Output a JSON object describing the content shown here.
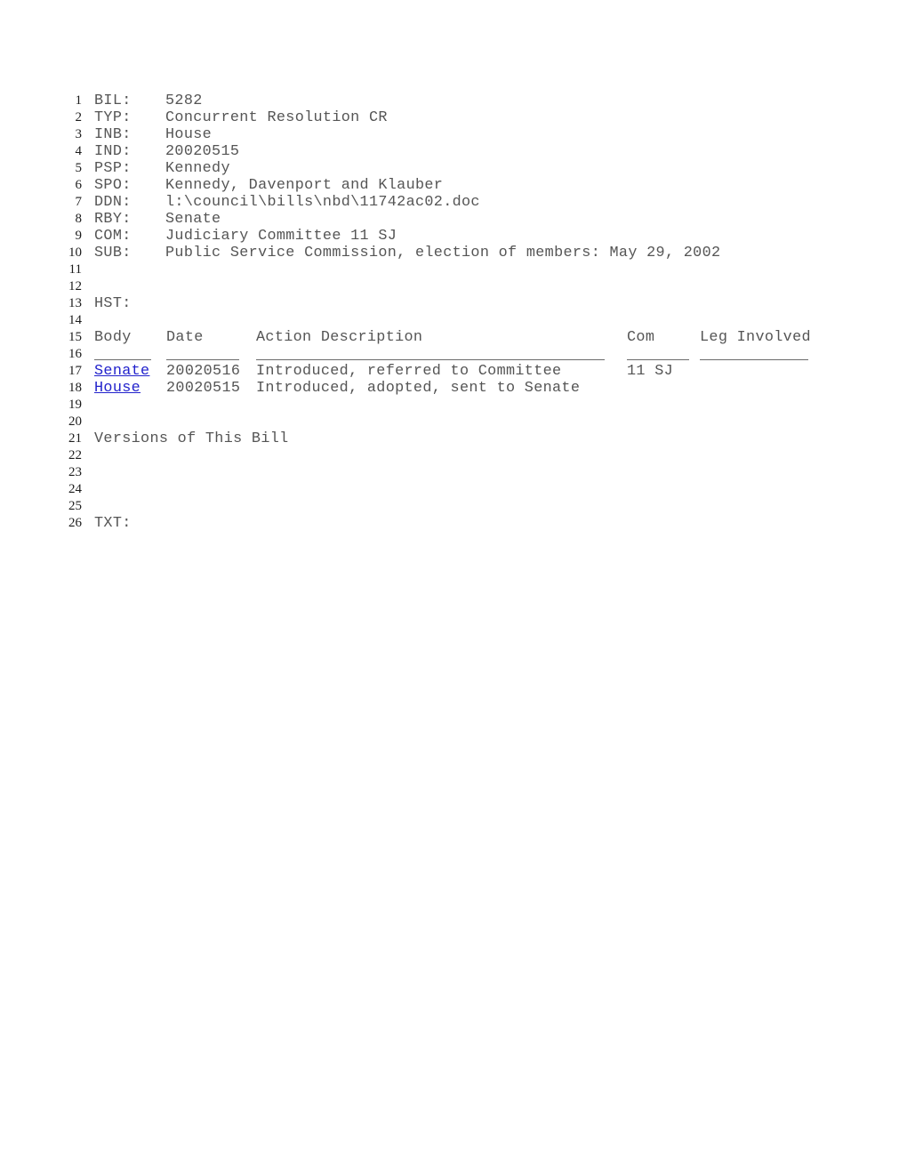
{
  "document": {
    "title": "Bill 5282 Legislative Record",
    "body_text_color": "#555555",
    "link_color": "#2222cc",
    "background_color": "#ffffff"
  },
  "fields": [
    {
      "lineno": "1",
      "label": "BIL:",
      "value": "5282"
    },
    {
      "lineno": "2",
      "label": "TYP:",
      "value": "Concurrent Resolution CR"
    },
    {
      "lineno": "3",
      "label": "INB:",
      "value": "House"
    },
    {
      "lineno": "4",
      "label": "IND:",
      "value": "20020515"
    },
    {
      "lineno": "5",
      "label": "PSP:",
      "value": "Kennedy"
    },
    {
      "lineno": "6",
      "label": "SPO:",
      "value": "Kennedy, Davenport and Klauber"
    },
    {
      "lineno": "7",
      "label": "DDN:",
      "value": "l:\\council\\bills\\nbd\\11742ac02.doc"
    },
    {
      "lineno": "8",
      "label": "RBY:",
      "value": "Senate"
    },
    {
      "lineno": "9",
      "label": "COM:",
      "value": "Judiciary Committee 11 SJ"
    },
    {
      "lineno": "10",
      "label": "SUB:",
      "value": "Public Service Commission, election of members: May 29, 2002"
    }
  ],
  "blank_lines": {
    "l11": "11",
    "l12": "12",
    "l14": "14",
    "l16": "16",
    "l19": "19",
    "l20": "20",
    "l22": "22",
    "l23": "23",
    "l24": "24",
    "l25": "25"
  },
  "history": {
    "lineno_heading": "13",
    "heading": "HST:",
    "lineno_columns": "15",
    "columns": {
      "body": "Body",
      "date": "Date",
      "action": "Action Description",
      "com": "Com",
      "leg": "Leg Involved"
    },
    "rows": [
      {
        "lineno": "17",
        "body": "Senate",
        "date": "20020516",
        "action": "Introduced, referred to Committee",
        "com": "11 SJ",
        "leg": ""
      },
      {
        "lineno": "18",
        "body": "House",
        "date": "20020515",
        "action": "Introduced, adopted, sent to Senate",
        "com": "",
        "leg": ""
      }
    ]
  },
  "versions": {
    "lineno": "21",
    "label": "Versions of This Bill"
  },
  "text_section": {
    "lineno": "26",
    "label": "TXT:"
  }
}
